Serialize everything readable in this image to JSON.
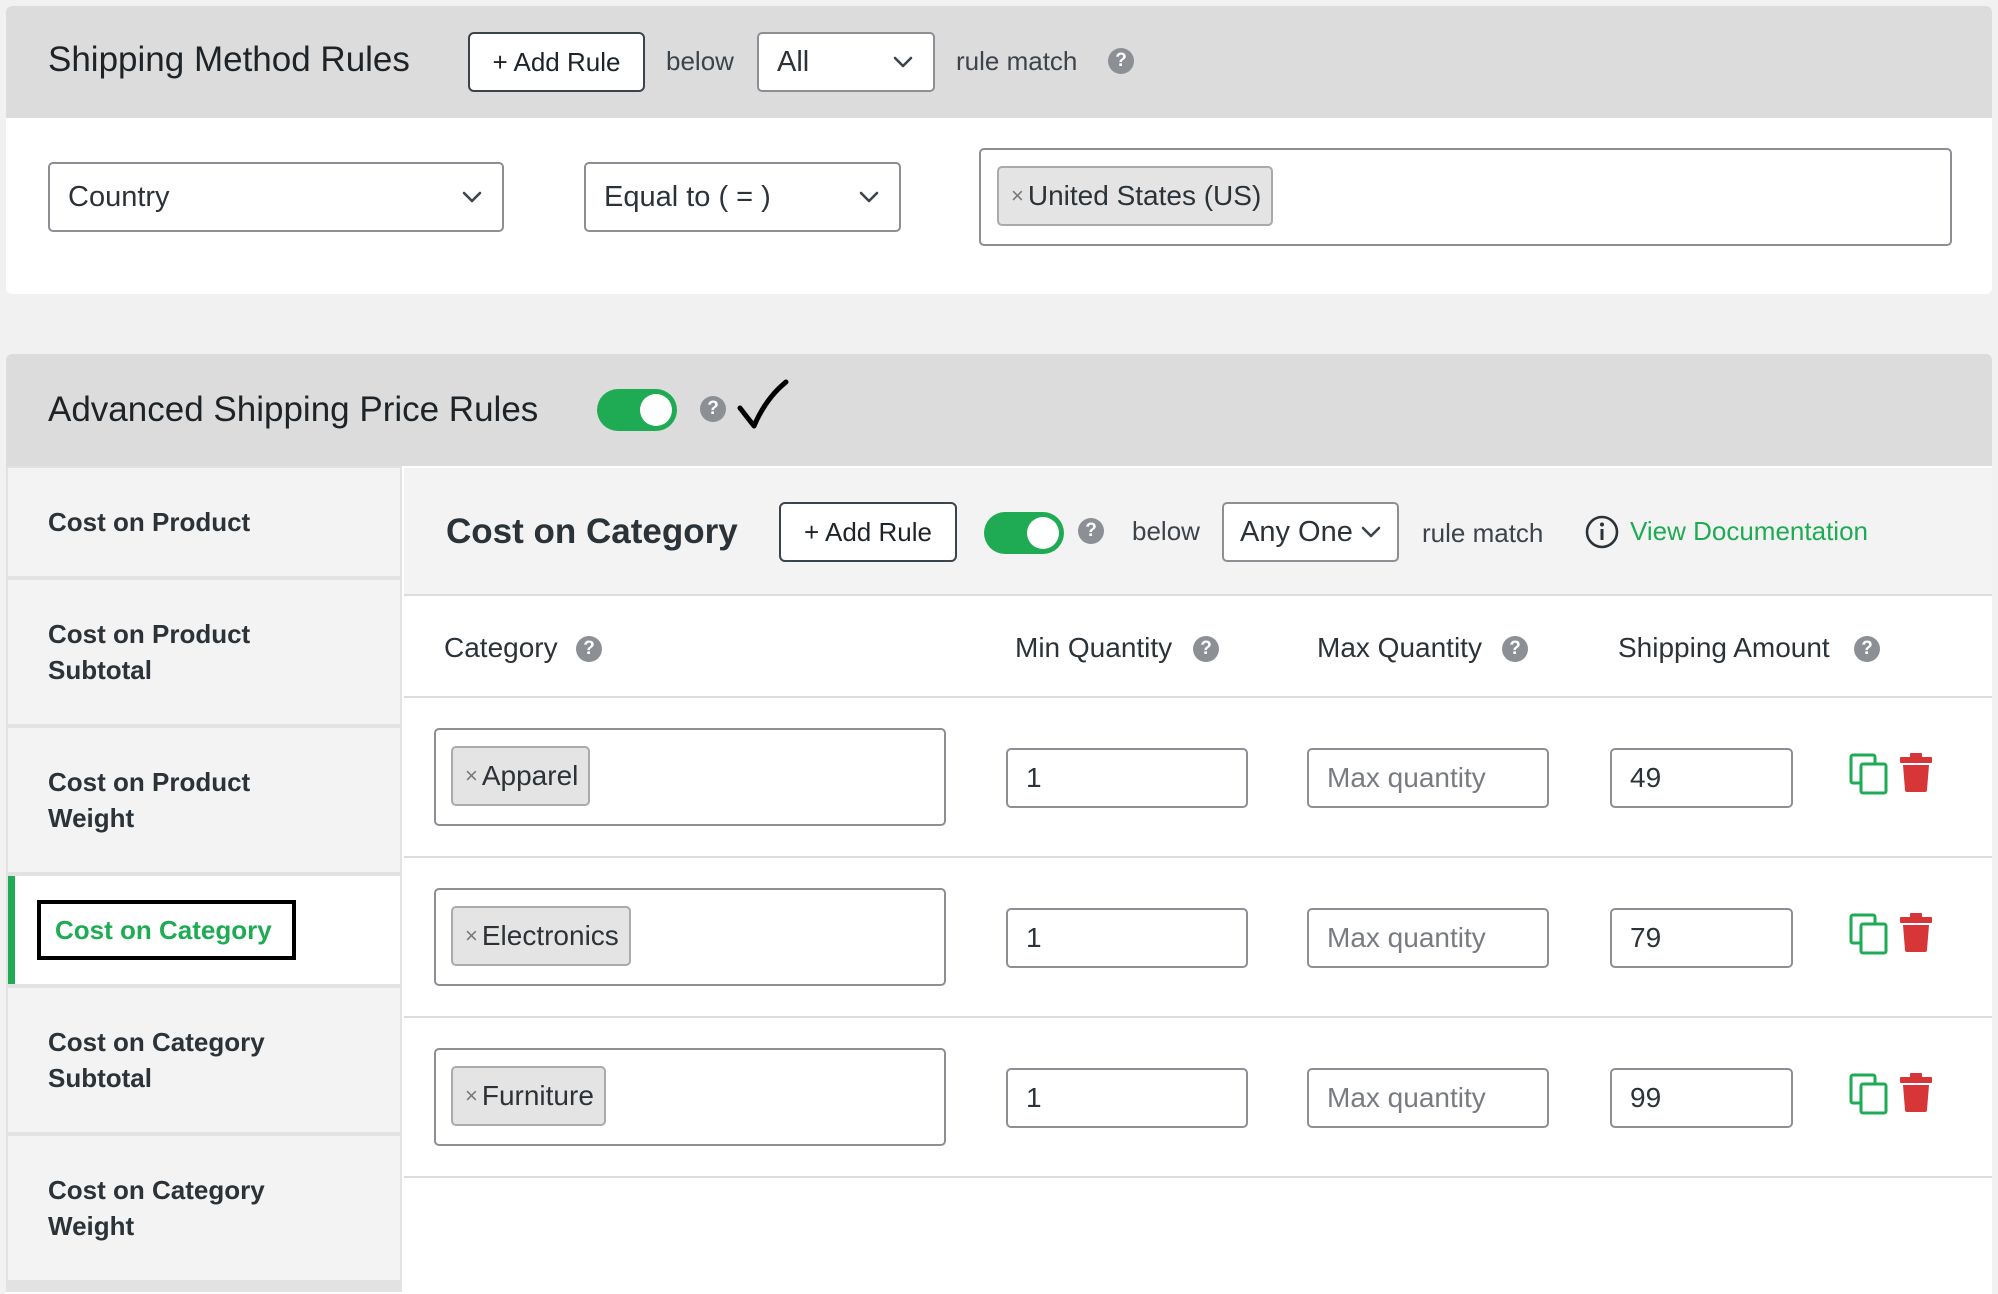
{
  "shipping_method_rules": {
    "title": "Shipping Method Rules",
    "add_rule_label": "+ Add Rule",
    "below_label": "below",
    "match_select_value": "All",
    "rule_match_label": "rule match",
    "help_glyph": "?",
    "condition": {
      "field_value": "Country",
      "operator_value": "Equal to ( = )",
      "tags": [
        "United States (US)"
      ]
    }
  },
  "advanced_shipping": {
    "title": "Advanced Shipping Price Rules",
    "enabled": true,
    "help_glyph": "?",
    "check_glyph": "✓"
  },
  "sidebar": {
    "items": [
      {
        "label": "Cost on Product",
        "active": false
      },
      {
        "label": "Cost on Product Subtotal",
        "active": false
      },
      {
        "label": "Cost on Product Weight",
        "active": false
      },
      {
        "label": "Cost on Category",
        "active": true
      },
      {
        "label": "Cost on Category Subtotal",
        "active": false
      },
      {
        "label": "Cost on Category Weight",
        "active": false
      }
    ]
  },
  "panel": {
    "title": "Cost on Category",
    "add_rule_label": "+ Add Rule",
    "enabled": true,
    "below_label": "below",
    "match_select_value": "Any One",
    "rule_match_label": "rule match",
    "doc_link_label": "View Documentation",
    "info_glyph": "i",
    "columns": {
      "category": "Category",
      "min_quantity": "Min Quantity",
      "max_quantity": "Max Quantity",
      "shipping_amount": "Shipping Amount"
    },
    "rows": [
      {
        "category": "Apparel",
        "min": "1",
        "max": "",
        "max_placeholder": "Max quantity",
        "amount": "49"
      },
      {
        "category": "Electronics",
        "min": "1",
        "max": "",
        "max_placeholder": "Max quantity",
        "amount": "79"
      },
      {
        "category": "Furniture",
        "min": "1",
        "max": "",
        "max_placeholder": "Max quantity",
        "amount": "99"
      }
    ]
  },
  "colors": {
    "accent_green": "#1fab54",
    "delete_red": "#d63638",
    "header_gray": "#dcdcdc"
  },
  "icons": [
    "chevron-down-icon",
    "help-icon",
    "info-icon",
    "copy-icon",
    "trash-icon",
    "remove-tag-icon",
    "checkmark-icon"
  ]
}
